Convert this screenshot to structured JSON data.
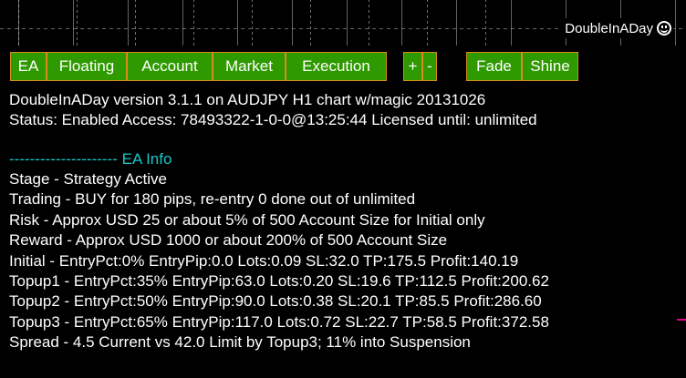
{
  "brand": {
    "name": "DoubleInADay",
    "icon": "smiley-icon"
  },
  "toolbar": {
    "tabs": [
      "EA",
      "Floating",
      "Account",
      "Market",
      "Execution"
    ],
    "plus": "+",
    "minus": "-",
    "fade": "Fade",
    "shine": "Shine"
  },
  "header": {
    "version_line": "DoubleInADay version 3.1.1 on AUDJPY H1 chart w/magic 20131026",
    "status_line": "Status: Enabled Access: 78493322-1-0-0@13:25:44 Licensed until: unlimited"
  },
  "info": {
    "section_title": "--------------------- EA Info",
    "lines": [
      "Stage - Strategy Active",
      "Trading - BUY for 180 pips, re-entry 0 done out of unlimited",
      "Risk -  Approx USD 25 or about 5% of 500 Account Size for Initial only",
      "Reward - Approx USD 1000 or about 200% of 500 Account Size",
      "Initial - EntryPct:0% EntryPip:0.0 Lots:0.09 SL:32.0 TP:175.5 Profit:140.19",
      "Topup1 - EntryPct:35% EntryPip:63.0 Lots:0.20 SL:19.6 TP:112.5 Profit:200.62",
      "Topup2 - EntryPct:50% EntryPip:90.0 Lots:0.38 SL:20.1 TP:85.5 Profit:286.60",
      "Topup3 - EntryPct:65% EntryPip:117.0 Lots:0.72 SL:22.7 TP:58.5 Profit:372.58",
      "Spread - 4.5 Current vs 42.0 Limit by Topup3; 11% into Suspension"
    ]
  },
  "colors": {
    "button_bg": "#2f9a00",
    "button_border": "#d88c1c",
    "section_title": "#19c6c6",
    "marker": "#e0008a"
  }
}
